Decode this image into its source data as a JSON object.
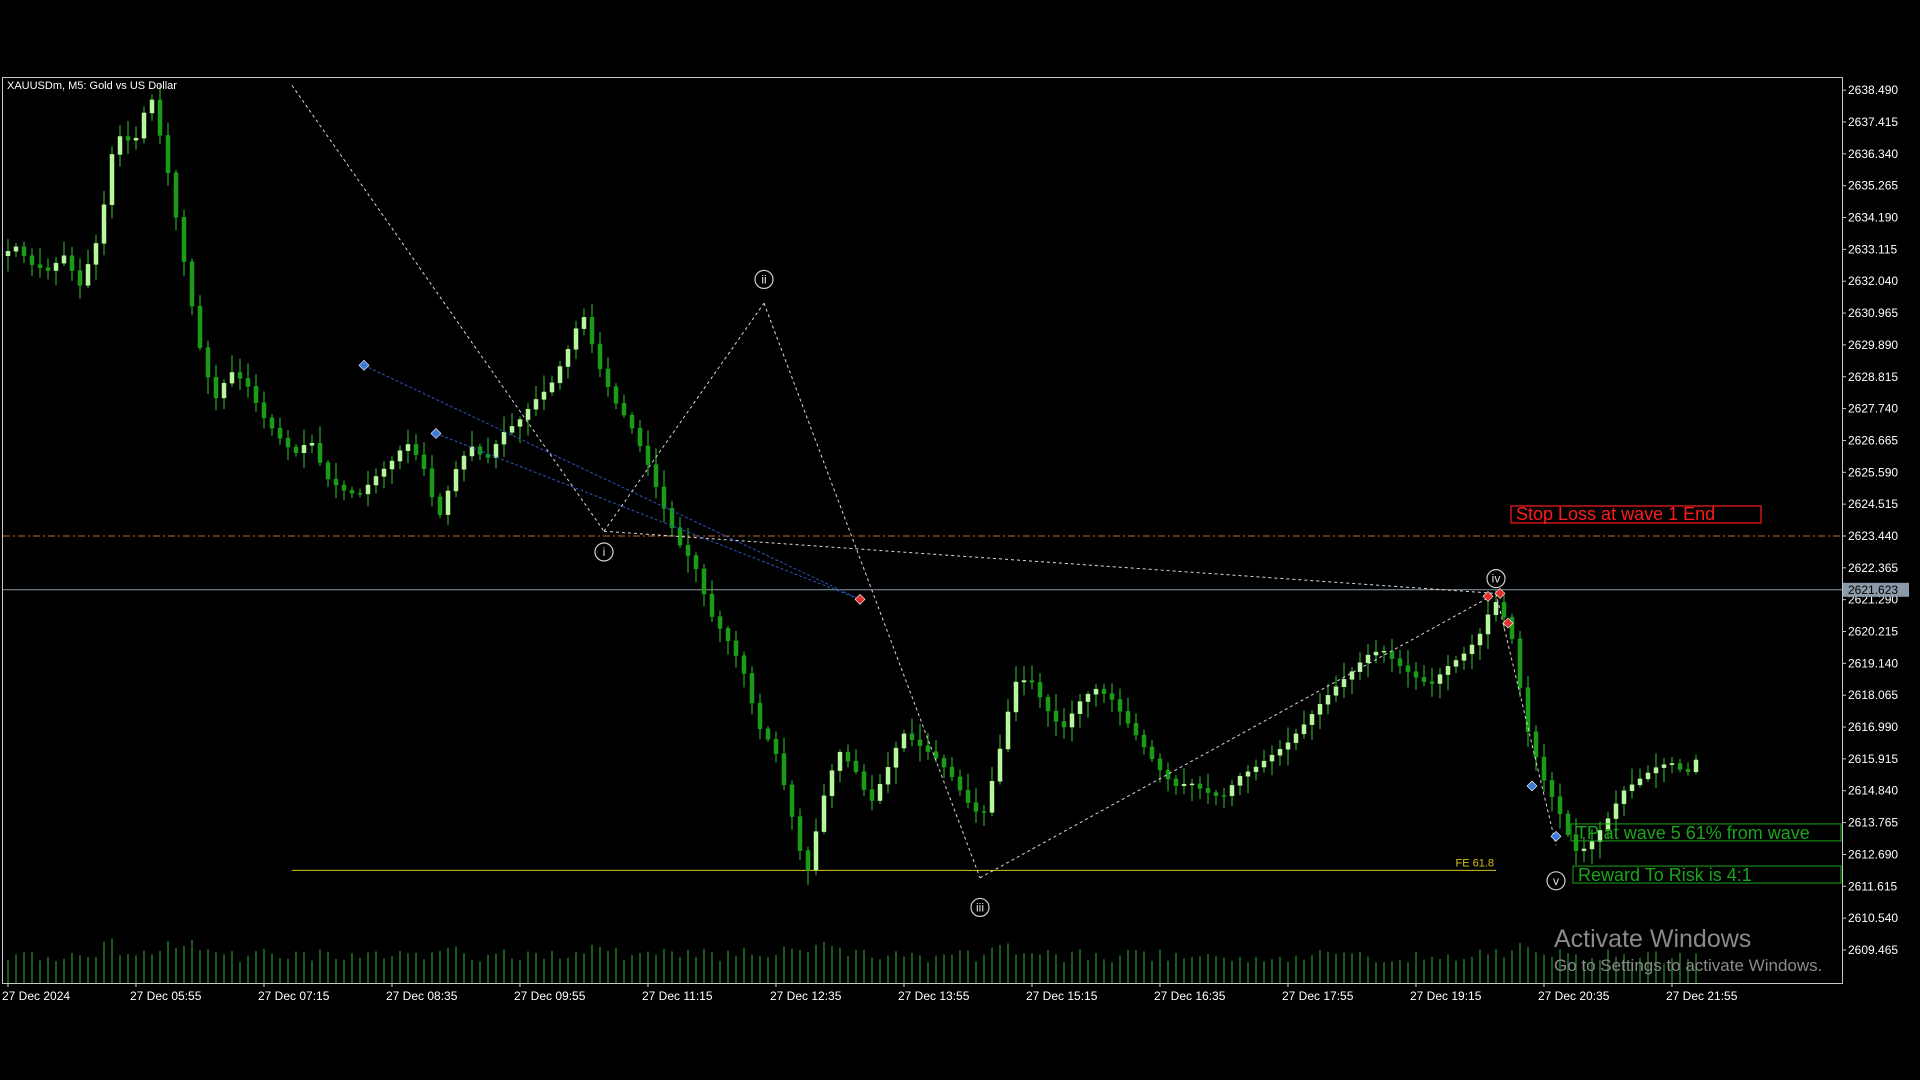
{
  "window": {
    "symbol_title": "XAUUSDm, M5:  Gold vs US Dollar"
  },
  "colors": {
    "background": "#000000",
    "frame": "#c8c8c8",
    "bull_candle": "#b8f5a0",
    "bear_candle": "#1a9c1a",
    "wick": "#34c434",
    "volume": "#1f7a1f",
    "wave_line": "#d8d8d8",
    "stop_loss_line": "#c26a2c",
    "stop_loss_text": "#ff1c1c",
    "tp_text": "#1aa61a",
    "fe_line": "#d8c21a",
    "bid_line": "#8a9aa8",
    "trend_line_blue": "#2a56b8"
  },
  "chart_data": {
    "type": "candlestick",
    "title": "XAUUSDm, M5:  Gold vs US Dollar",
    "price_axis_labels": [
      "2638.490",
      "2637.415",
      "2636.340",
      "2635.265",
      "2634.190",
      "2633.115",
      "2632.040",
      "2630.965",
      "2629.890",
      "2628.815",
      "2627.740",
      "2626.665",
      "2625.590",
      "2624.515",
      "2623.440",
      "2622.365",
      "2621.290",
      "2620.215",
      "2619.140",
      "2618.065",
      "2616.990",
      "2615.915",
      "2614.840",
      "2613.765",
      "2612.690",
      "2611.615",
      "2610.540",
      "2609.465"
    ],
    "price_axis_values": [
      2638.49,
      2637.415,
      2636.34,
      2635.265,
      2634.19,
      2633.115,
      2632.04,
      2630.965,
      2629.89,
      2628.815,
      2627.74,
      2626.665,
      2625.59,
      2624.515,
      2623.44,
      2622.365,
      2621.29,
      2620.215,
      2619.14,
      2618.065,
      2616.99,
      2615.915,
      2614.84,
      2613.765,
      2612.69,
      2611.615,
      2610.54,
      2609.465
    ],
    "ylim": [
      2608.35,
      2638.9
    ],
    "time_axis_labels": [
      "27 Dec 2024",
      "27 Dec 05:55",
      "27 Dec 07:15",
      "27 Dec 08:35",
      "27 Dec 09:55",
      "27 Dec 11:15",
      "27 Dec 12:35",
      "27 Dec 13:55",
      "27 Dec 15:15",
      "27 Dec 16:35",
      "27 Dec 17:55",
      "27 Dec 19:15",
      "27 Dec 20:35",
      "27 Dec 21:55"
    ],
    "bars_total": 212,
    "bars_per_label": 16,
    "current_price": "2621.623",
    "current_price_value": 2621.623,
    "path_points": [
      [
        0,
        2632.9
      ],
      [
        5,
        2633.2
      ],
      [
        10,
        2632.6
      ],
      [
        15,
        2632.4
      ],
      [
        20,
        2632.9
      ],
      [
        25,
        2631.9
      ],
      [
        31,
        2633.6
      ],
      [
        36,
        2637.0
      ],
      [
        42,
        2636.7
      ],
      [
        47,
        2638.4
      ],
      [
        52,
        2636.0
      ],
      [
        57,
        2633.0
      ],
      [
        62,
        2630.0
      ],
      [
        67,
        2628.0
      ],
      [
        72,
        2629.0
      ],
      [
        77,
        2628.6
      ],
      [
        82,
        2627.5
      ],
      [
        87,
        2626.8
      ],
      [
        92,
        2626.2
      ],
      [
        97,
        2626.7
      ],
      [
        102,
        2625.4
      ],
      [
        107,
        2625.0
      ],
      [
        112,
        2624.8
      ],
      [
        117,
        2625.4
      ],
      [
        122,
        2625.9
      ],
      [
        127,
        2626.6
      ],
      [
        132,
        2625.9
      ],
      [
        137,
        2624.0
      ],
      [
        142,
        2625.6
      ],
      [
        147,
        2626.5
      ],
      [
        152,
        2626.0
      ],
      [
        157,
        2626.9
      ],
      [
        162,
        2627.3
      ],
      [
        167,
        2628.0
      ],
      [
        172,
        2628.5
      ],
      [
        177,
        2629.6
      ],
      [
        182,
        2631.0
      ],
      [
        187,
        2629.2
      ],
      [
        192,
        2628.0
      ],
      [
        197,
        2627.2
      ],
      [
        202,
        2626.0
      ],
      [
        207,
        2624.5
      ],
      [
        212,
        2623.2
      ],
      [
        217,
        2622.5
      ],
      [
        222,
        2620.8
      ],
      [
        227,
        2620.0
      ],
      [
        232,
        2619.0
      ],
      [
        237,
        2617.0
      ],
      [
        242,
        2616.3
      ],
      [
        247,
        2614.2
      ],
      [
        252,
        2611.9
      ],
      [
        257,
        2614.5
      ],
      [
        262,
        2616.2
      ],
      [
        267,
        2615.6
      ],
      [
        272,
        2614.4
      ],
      [
        277,
        2615.5
      ],
      [
        282,
        2616.8
      ],
      [
        287,
        2616.4
      ],
      [
        292,
        2616.0
      ],
      [
        297,
        2615.4
      ],
      [
        302,
        2614.5
      ],
      [
        307,
        2613.9
      ],
      [
        312,
        2616.0
      ],
      [
        317,
        2618.5
      ],
      [
        322,
        2618.6
      ],
      [
        327,
        2617.6
      ],
      [
        332,
        2616.9
      ],
      [
        337,
        2617.8
      ],
      [
        342,
        2618.3
      ],
      [
        347,
        2618.0
      ],
      [
        352,
        2617.2
      ],
      [
        357,
        2616.4
      ],
      [
        362,
        2615.6
      ],
      [
        367,
        2615.0
      ],
      [
        372,
        2615.1
      ],
      [
        377,
        2614.8
      ],
      [
        382,
        2614.6
      ],
      [
        387,
        2615.3
      ],
      [
        392,
        2615.6
      ],
      [
        397,
        2616.0
      ],
      [
        402,
        2616.4
      ],
      [
        407,
        2617.0
      ],
      [
        412,
        2617.7
      ],
      [
        417,
        2618.3
      ],
      [
        422,
        2618.8
      ],
      [
        427,
        2619.4
      ],
      [
        432,
        2619.6
      ],
      [
        437,
        2619.1
      ],
      [
        442,
        2618.7
      ],
      [
        447,
        2618.4
      ],
      [
        452,
        2619.0
      ],
      [
        457,
        2619.4
      ],
      [
        462,
        2620.0
      ],
      [
        467,
        2621.3
      ],
      [
        472,
        2620.3
      ],
      [
        477,
        2617.0
      ],
      [
        482,
        2615.3
      ],
      [
        487,
        2614.2
      ],
      [
        492,
        2612.8
      ],
      [
        496,
        2612.9
      ],
      [
        502,
        2613.8
      ],
      [
        507,
        2614.8
      ],
      [
        512,
        2615.2
      ],
      [
        517,
        2615.6
      ],
      [
        522,
        2615.8
      ],
      [
        527,
        2615.4
      ],
      [
        532,
        2616.2
      ],
      [
        537,
        2618.2
      ],
      [
        542,
        2620.6
      ],
      [
        546,
        2621.6
      ]
    ],
    "wave_labels": [
      {
        "text": "i",
        "bar": 74.5,
        "price": 2622.9
      },
      {
        "text": "ii",
        "bar": 94.5,
        "price": 2632.1
      },
      {
        "text": "iii",
        "bar": 121.5,
        "price": 2610.9
      },
      {
        "text": "iv",
        "bar": 186,
        "price": 2622.0
      },
      {
        "text": "v",
        "bar": 193.5,
        "price": 2611.8
      }
    ],
    "wave_lines": [
      [
        [
          35.5,
          2638.65
        ],
        [
          74.5,
          2623.6
        ]
      ],
      [
        [
          74.5,
          2623.6
        ],
        [
          94.5,
          2631.3
        ]
      ],
      [
        [
          94.5,
          2631.3
        ],
        [
          121.5,
          2611.9
        ]
      ],
      [
        [
          121.5,
          2611.9
        ],
        [
          186,
          2621.5
        ]
      ],
      [
        [
          186,
          2621.5
        ],
        [
          193.5,
          2613.0
        ]
      ],
      [
        [
          74.5,
          2623.6
        ],
        [
          186,
          2621.5
        ]
      ]
    ],
    "blue_trend_lines": [
      [
        [
          44.5,
          2629.2
        ],
        [
          106.5,
          2621.3
        ]
      ],
      [
        [
          53.5,
          2626.9
        ],
        [
          106.5,
          2621.3
        ]
      ]
    ],
    "markers": [
      {
        "bar": 44.5,
        "price": 2629.2,
        "color": "blue"
      },
      {
        "bar": 53.5,
        "price": 2626.9,
        "color": "blue"
      },
      {
        "bar": 106.5,
        "price": 2621.3,
        "color": "red"
      },
      {
        "bar": 185,
        "price": 2621.4,
        "color": "red"
      },
      {
        "bar": 186.5,
        "price": 2621.5,
        "color": "red"
      },
      {
        "bar": 187.5,
        "price": 2620.5,
        "color": "red"
      },
      {
        "bar": 190.5,
        "price": 2615.0,
        "color": "blue"
      },
      {
        "bar": 193.5,
        "price": 2613.3,
        "color": "blue"
      }
    ],
    "stop_loss_price": 2623.44,
    "fe_price": 2612.15,
    "fe_line_from_bar": 35.5,
    "fe_line_to_bar": 186
  },
  "annotations": {
    "stop_loss": "Stop Loss at wave 1 End",
    "take_profit": "TP at wave 5 61% from wave",
    "reward_risk": "Reward To Risk  is 4:1",
    "fe_label": "FE 61.8"
  },
  "os_watermark": {
    "line1": "Activate Windows",
    "line2": "Go to Settings to activate Windows."
  }
}
